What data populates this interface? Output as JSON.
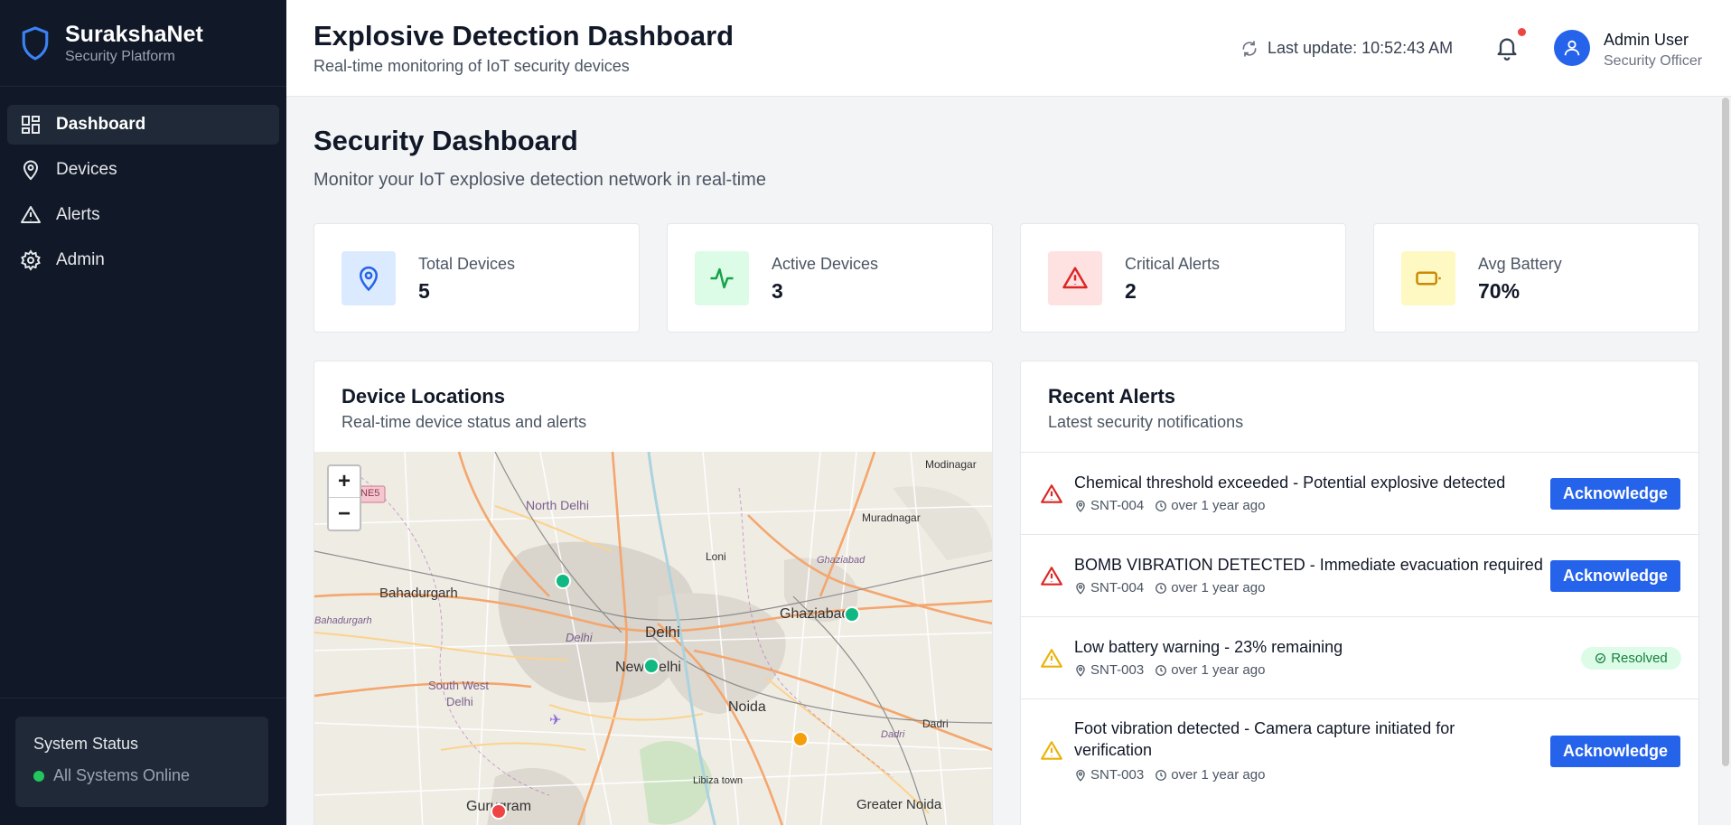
{
  "brand": {
    "title": "SurakshaNet",
    "subtitle": "Security Platform"
  },
  "nav": [
    {
      "label": "Dashboard",
      "icon": "grid-icon",
      "active": true
    },
    {
      "label": "Devices",
      "icon": "map-pin-icon"
    },
    {
      "label": "Alerts",
      "icon": "alert-triangle-icon"
    },
    {
      "label": "Admin",
      "icon": "gear-icon"
    }
  ],
  "system_status": {
    "title": "System Status",
    "status": "All Systems Online",
    "color": "#22c55e"
  },
  "header": {
    "title": "Explosive Detection Dashboard",
    "subtitle": "Real-time monitoring of IoT security devices",
    "last_update": "Last update: 10:52:43 AM"
  },
  "user": {
    "name": "Admin User",
    "role": "Security Officer"
  },
  "main": {
    "title": "Security Dashboard",
    "subtitle": "Monitor your IoT explosive detection network in real-time"
  },
  "stats": [
    {
      "label": "Total Devices",
      "value": "5",
      "icon": "map-pin-icon",
      "bg": "#dbeafe",
      "color": "#2563eb"
    },
    {
      "label": "Active Devices",
      "value": "3",
      "icon": "activity-icon",
      "bg": "#dcfce7",
      "color": "#16a34a"
    },
    {
      "label": "Critical Alerts",
      "value": "2",
      "icon": "alert-triangle-icon",
      "bg": "#fee2e2",
      "color": "#dc2626"
    },
    {
      "label": "Avg Battery",
      "value": "70%",
      "icon": "battery-icon",
      "bg": "#fef9c3",
      "color": "#ca8a04"
    }
  ],
  "device_locations": {
    "title": "Device Locations",
    "subtitle": "Real-time device status and alerts",
    "zoom_in": "+",
    "zoom_out": "−",
    "map_labels": {
      "north_delhi": "North Delhi",
      "bahadurgarh": "Bahadurgarh",
      "bahadurgarh_small": "Bahadurgarh",
      "delhi": "Delhi",
      "delhi_small": "Delhi",
      "new_delhi": "New Delhi",
      "ghaziabad": "Ghaziabad",
      "ghaziabad_small": "Ghaziabad",
      "noida": "Noida",
      "south_west_delhi_1": "South West",
      "south_west_delhi_2": "Delhi",
      "gurugram": "Gurugram",
      "greater_noida": "Greater Noida",
      "loni": "Loni",
      "modinagar": "Modinagar",
      "muradnagar": "Muradnagar",
      "dadri_small": "Dadri",
      "dadri": "Dadri",
      "libiza": "Libiza town",
      "ne5": "NE5"
    },
    "markers": [
      {
        "status": "active",
        "color": "#10b981"
      },
      {
        "status": "active",
        "color": "#10b981"
      },
      {
        "status": "active",
        "color": "#10b981"
      },
      {
        "status": "warning",
        "color": "#f59e0b"
      },
      {
        "status": "critical",
        "color": "#ef4444"
      }
    ]
  },
  "recent_alerts": {
    "title": "Recent Alerts",
    "subtitle": "Latest security notifications",
    "items": [
      {
        "message": "Chemical threshold exceeded - Potential explosive detected",
        "device": "SNT-004",
        "time": "over 1 year ago",
        "severity": "critical",
        "action": "Acknowledge"
      },
      {
        "message": "BOMB VIBRATION DETECTED - Immediate evacuation required",
        "device": "SNT-004",
        "time": "over 1 year ago",
        "severity": "critical",
        "action": "Acknowledge"
      },
      {
        "message": "Low battery warning - 23% remaining",
        "device": "SNT-003",
        "time": "over 1 year ago",
        "severity": "warning",
        "action": "Resolved"
      },
      {
        "message": "Foot vibration detected - Camera capture initiated for verification",
        "device": "SNT-003",
        "time": "over 1 year ago",
        "severity": "warning",
        "action": "Acknowledge"
      }
    ]
  }
}
